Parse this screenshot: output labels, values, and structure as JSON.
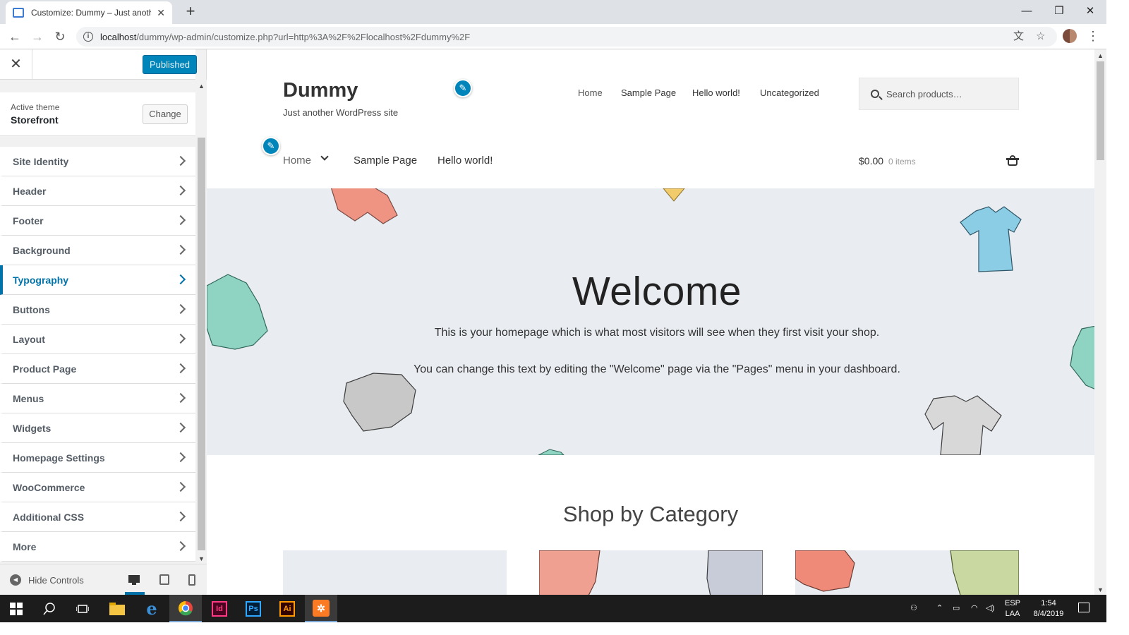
{
  "browser": {
    "tab_title": "Customize: Dummy – Just another",
    "url_host": "localhost",
    "url_path": "/dummy/wp-admin/customize.php?url=http%3A%2F%2Flocalhost%2Fdummy%2F"
  },
  "customizer": {
    "publish_label": "Published",
    "active_theme_label": "Active theme",
    "theme_name": "Storefront",
    "change_label": "Change",
    "panels": [
      {
        "label": "Site Identity",
        "active": false
      },
      {
        "label": "Header",
        "active": false
      },
      {
        "label": "Footer",
        "active": false
      },
      {
        "label": "Background",
        "active": false
      },
      {
        "label": "Typography",
        "active": true
      },
      {
        "label": "Buttons",
        "active": false
      },
      {
        "label": "Layout",
        "active": false
      },
      {
        "label": "Product Page",
        "active": false
      },
      {
        "label": "Menus",
        "active": false
      },
      {
        "label": "Widgets",
        "active": false
      },
      {
        "label": "Homepage Settings",
        "active": false
      },
      {
        "label": "WooCommerce",
        "active": false
      },
      {
        "label": "Additional CSS",
        "active": false
      },
      {
        "label": "More",
        "active": false
      }
    ],
    "hide_controls_label": "Hide Controls",
    "accent_color": "#0073aa"
  },
  "site": {
    "title": "Dummy",
    "tagline": "Just another WordPress site",
    "secondary_nav": [
      "Home",
      "Sample Page",
      "Hello world!",
      "Uncategorized"
    ],
    "search_placeholder": "Search products…",
    "primary_nav": [
      "Home",
      "Sample Page",
      "Hello world!"
    ],
    "cart_amount": "$0.00",
    "cart_count": "0 items",
    "hero_title": "Welcome",
    "hero_p1": "This is your homepage which is what most visitors will see when they first visit your shop.",
    "hero_p2": "You can change this text by editing the \"Welcome\" page via the \"Pages\" menu in your dashboard.",
    "section_title": "Shop by Category"
  },
  "taskbar": {
    "apps": [
      "start",
      "search",
      "task-view",
      "file-explorer",
      "edge",
      "chrome",
      "indesign",
      "photoshop",
      "illustrator",
      "xampp"
    ],
    "app_labels": {
      "indesign": "Id",
      "photoshop": "Ps",
      "illustrator": "Ai"
    },
    "lang_top": "ESP",
    "lang_bottom": "LAA",
    "time": "1:54",
    "date": "8/4/2019"
  }
}
